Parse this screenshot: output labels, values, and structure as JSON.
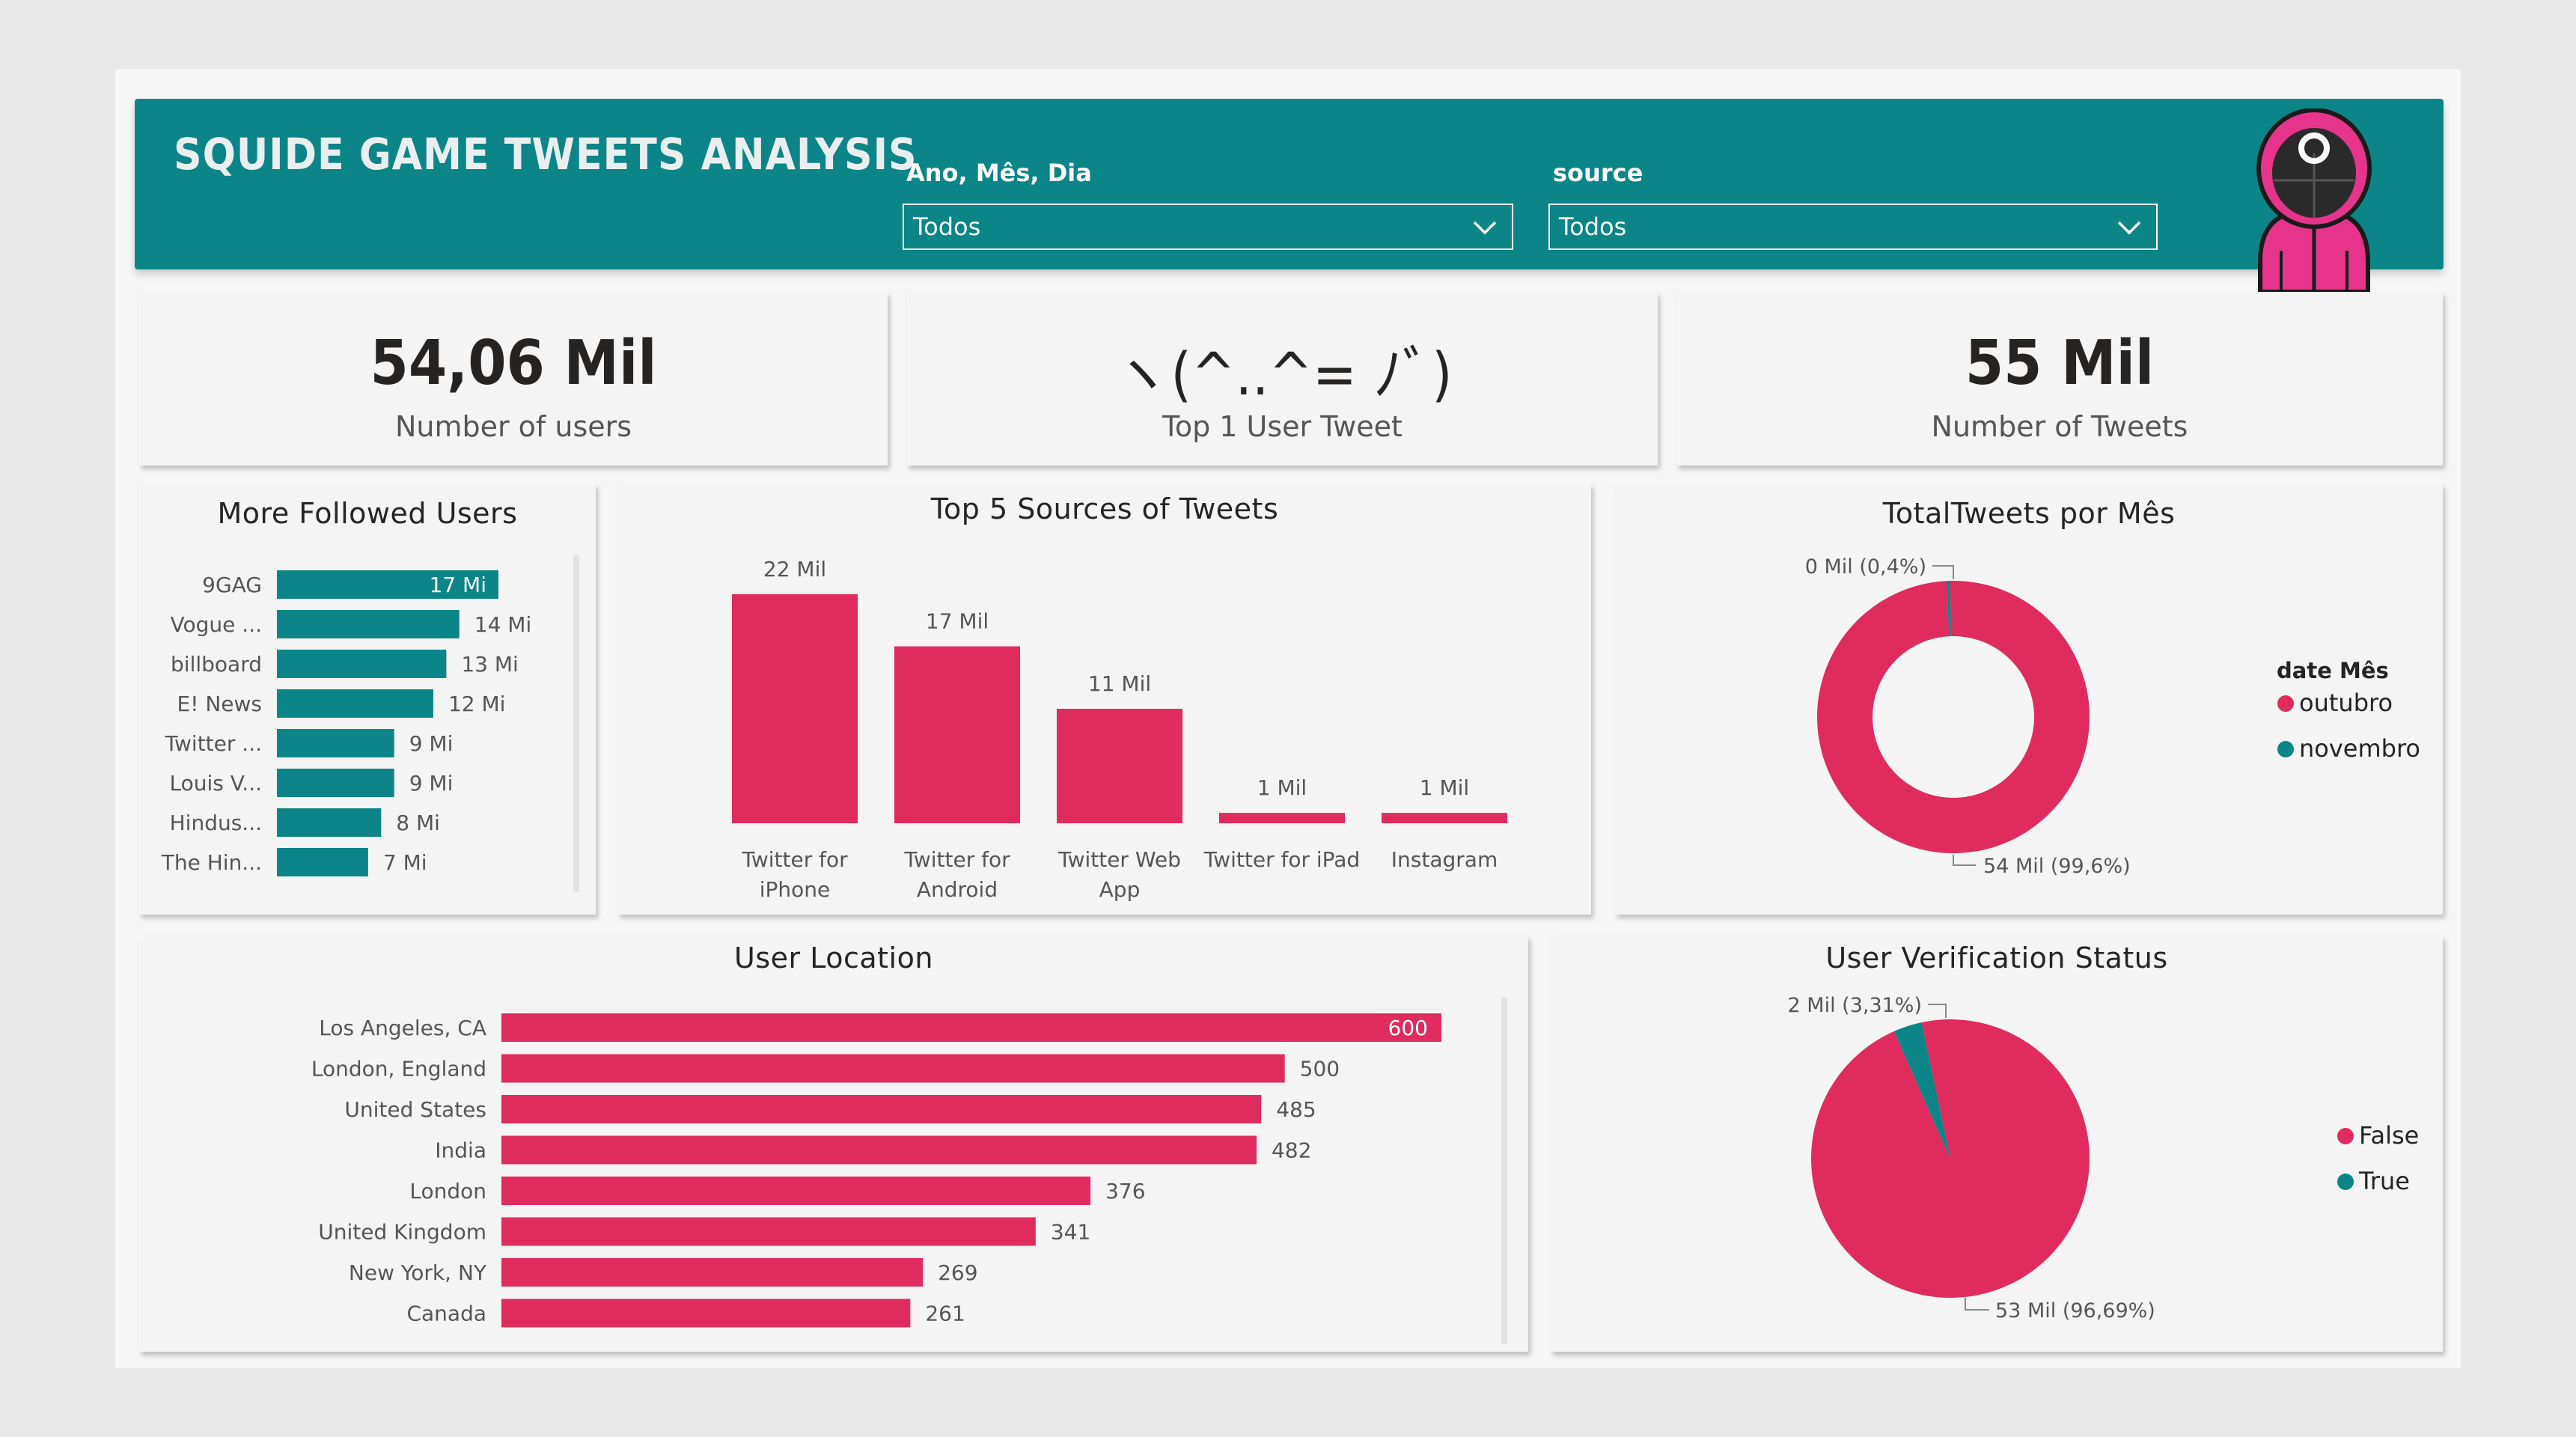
{
  "header": {
    "title": "SQUIDE GAME TWEETS ANALYSIS",
    "filters": [
      {
        "label": "Ano, Mês, Dia",
        "value": "Todos"
      },
      {
        "label": "source",
        "value": "Todos"
      }
    ]
  },
  "kpis": {
    "users": {
      "value": "54,06 Mil",
      "label": "Number of users"
    },
    "top_user": {
      "value": "ヽ(^..^= ﾉﾞ)",
      "label": "Top 1 User Tweet"
    },
    "tweets": {
      "value": "55 Mil",
      "label": "Number of Tweets"
    }
  },
  "colors": {
    "teal": "#0b8588",
    "pink": "#e02b5e"
  },
  "chart_data": [
    {
      "type": "bar",
      "orientation": "horizontal",
      "title": "More Followed Users",
      "categories": [
        "9GAG",
        "Vogue ...",
        "billboard",
        "E! News",
        "Twitter ...",
        "Louis V...",
        "Hindus...",
        "The Hin..."
      ],
      "values": [
        17,
        14,
        13,
        12,
        9,
        9,
        8,
        7
      ],
      "data_labels": [
        "17 Mi",
        "14 Mi",
        "13 Mi",
        "12 Mi",
        "9 Mi",
        "9 Mi",
        "8 Mi",
        "7 Mi"
      ],
      "color": "#0b8588"
    },
    {
      "type": "bar",
      "title": "Top 5 Sources of Tweets",
      "categories": [
        "Twitter for iPhone",
        "Twitter for Android",
        "Twitter Web App",
        "Twitter for iPad",
        "Instagram"
      ],
      "category_lines": [
        [
          "Twitter for",
          "iPhone"
        ],
        [
          "Twitter for",
          "Android"
        ],
        [
          "Twitter Web",
          "App"
        ],
        [
          "Twitter for iPad"
        ],
        [
          "Instagram"
        ]
      ],
      "values": [
        22,
        17,
        11,
        1,
        1
      ],
      "data_labels": [
        "22 Mil",
        "17 Mil",
        "11 Mil",
        "1 Mil",
        "1 Mil"
      ],
      "color": "#e02b5e"
    },
    {
      "type": "pie",
      "donut": true,
      "title": "TotalTweets por Mês",
      "legend_title": "date Mês",
      "legend_position": "right",
      "labels": [
        "outubro",
        "novembro"
      ],
      "values": [
        99.6,
        0.4
      ],
      "data_labels": [
        "54 Mil (99,6%)",
        "0 Mil (0,4%)"
      ],
      "colors": [
        "#e02b5e",
        "#0b8588"
      ]
    },
    {
      "type": "bar",
      "orientation": "horizontal",
      "title": "User Location",
      "categories": [
        "Los Angeles, CA",
        "London, England",
        "United States",
        "India",
        "London",
        "United Kingdom",
        "New York, NY",
        "Canada"
      ],
      "values": [
        600,
        500,
        485,
        482,
        376,
        341,
        269,
        261
      ],
      "color": "#e02b5e"
    },
    {
      "type": "pie",
      "title": "User Verification Status",
      "legend_position": "right",
      "labels": [
        "False",
        "True"
      ],
      "values": [
        96.69,
        3.31
      ],
      "data_labels": [
        "53 Mil (96,69%)",
        "2 Mil (3,31%)"
      ],
      "colors": [
        "#e02b5e",
        "#0b8588"
      ]
    }
  ]
}
